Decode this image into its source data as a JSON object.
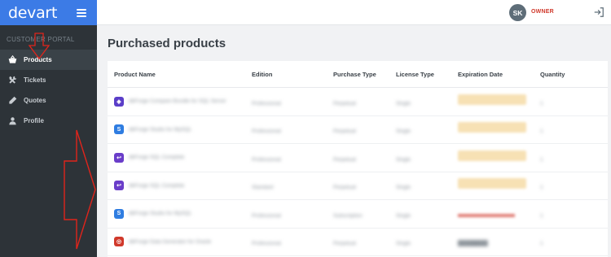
{
  "app": {
    "logo": "devart"
  },
  "sidebar": {
    "section_title": "CUSTOMER PORTAL",
    "items": [
      {
        "label": "Products",
        "icon": "basket-icon",
        "active": true
      },
      {
        "label": "Tickets",
        "icon": "tools-icon",
        "active": false
      },
      {
        "label": "Quotes",
        "icon": "pencil-icon",
        "active": false
      },
      {
        "label": "Profile",
        "icon": "user-icon",
        "active": false
      }
    ]
  },
  "topbar": {
    "avatar_initials": "SK",
    "role": "OWNER"
  },
  "main": {
    "title": "Purchased products",
    "columns": [
      "Product Name",
      "Edition",
      "Purchase Type",
      "License Type",
      "Expiration Date",
      "Quantity"
    ],
    "rows": [
      {
        "product": "dbForge Compare Bundle for SQL Server",
        "edition": "Professional",
        "purchase_type": "Perpetual",
        "license_type": "Single",
        "expiration": "",
        "quantity": "1",
        "icon_color": "#5b3ec8",
        "icon_glyph": "◈"
      },
      {
        "product": "dbForge Studio for MySQL",
        "edition": "Professional",
        "purchase_type": "Perpetual",
        "license_type": "Single",
        "expiration": "",
        "quantity": "1",
        "icon_color": "#2f7de1",
        "icon_glyph": "S"
      },
      {
        "product": "dbForge SQL Complete",
        "edition": "Professional",
        "purchase_type": "Perpetual",
        "license_type": "Single",
        "expiration": "",
        "quantity": "1",
        "icon_color": "#6a3dc9",
        "icon_glyph": "↩"
      },
      {
        "product": "dbForge SQL Complete",
        "edition": "Standard",
        "purchase_type": "Perpetual",
        "license_type": "Single",
        "expiration": "",
        "quantity": "1",
        "icon_color": "#6a3dc9",
        "icon_glyph": "↩"
      },
      {
        "product": "dbForge Studio for MySQL",
        "edition": "Professional",
        "purchase_type": "Subscription",
        "license_type": "Single",
        "expiration": "",
        "quantity": "1",
        "icon_color": "#2f7de1",
        "icon_glyph": "S"
      },
      {
        "product": "dbForge Data Generator for Oracle",
        "edition": "Professional",
        "purchase_type": "Perpetual",
        "license_type": "Single",
        "expiration": "",
        "quantity": "1",
        "icon_color": "#d0392b",
        "icon_glyph": "◎"
      }
    ]
  },
  "colors": {
    "brand": "#3c7be6",
    "sidebar": "#2d3338",
    "role": "#d0392b",
    "annotation": "#e0241b"
  }
}
